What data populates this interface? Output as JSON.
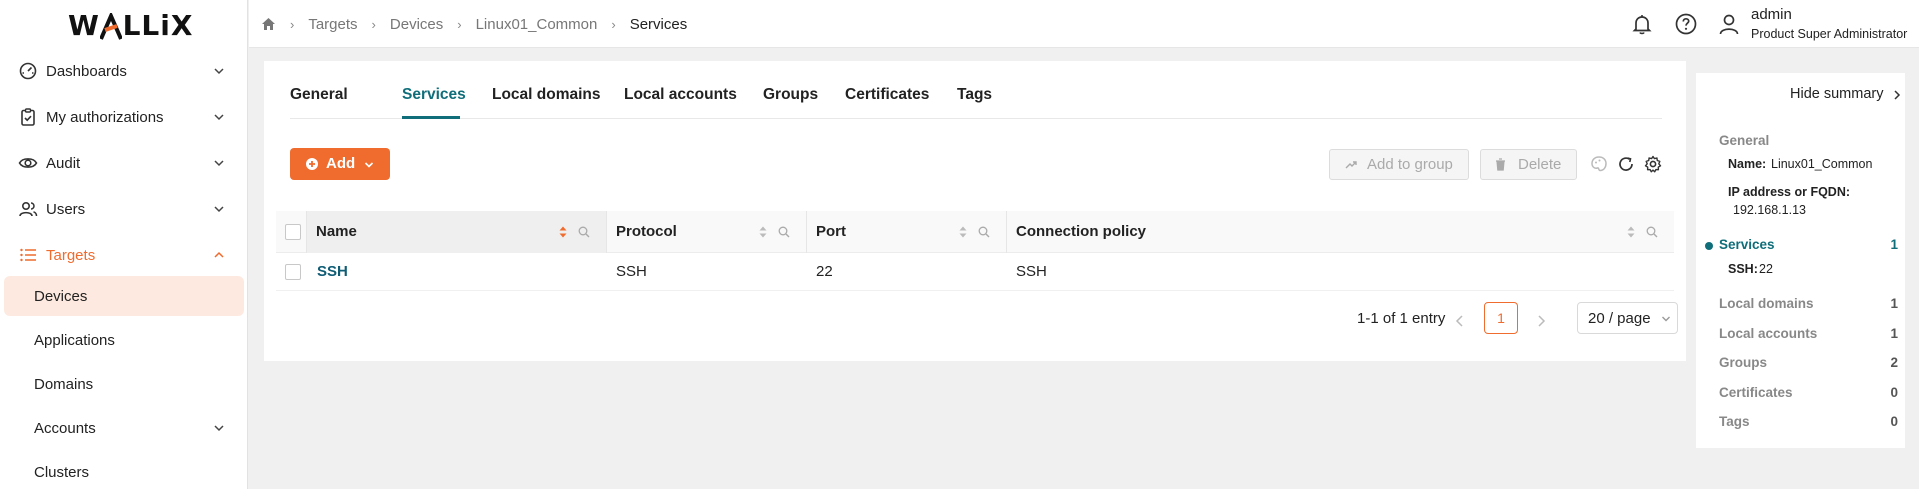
{
  "logo": {
    "text_left": "W",
    "text_mid": "A",
    "text_right": "LLiX"
  },
  "sidebar": {
    "items": [
      {
        "label": "Dashboards",
        "icon": "dashboard-icon"
      },
      {
        "label": "My authorizations",
        "icon": "clipboard-check-icon"
      },
      {
        "label": "Audit",
        "icon": "eye-icon"
      },
      {
        "label": "Users",
        "icon": "users-icon"
      },
      {
        "label": "Targets",
        "icon": "list-icon"
      }
    ],
    "sub_items": [
      {
        "label": "Devices"
      },
      {
        "label": "Applications"
      },
      {
        "label": "Domains"
      },
      {
        "label": "Accounts"
      },
      {
        "label": "Clusters"
      }
    ]
  },
  "breadcrumb": [
    "Targets",
    "Devices",
    "Linux01_Common",
    "Services"
  ],
  "user": {
    "name": "admin",
    "role": "Product Super Administrator"
  },
  "tabs": [
    "General",
    "Services",
    "Local domains",
    "Local accounts",
    "Groups",
    "Certificates",
    "Tags"
  ],
  "toolbar": {
    "add_label": "Add",
    "add_to_group_label": "Add to group",
    "delete_label": "Delete"
  },
  "table": {
    "columns": [
      "Name",
      "Protocol",
      "Port",
      "Connection policy"
    ],
    "rows": [
      {
        "name": "SSH",
        "protocol": "SSH",
        "port": "22",
        "policy": "SSH"
      }
    ]
  },
  "pagination": {
    "summary": "1-1 of 1 entry",
    "current_page": "1",
    "page_size": "20 / page"
  },
  "summary": {
    "hide_label": "Hide summary",
    "general_title": "General",
    "name_label": "Name:",
    "name_value": "Linux01_Common",
    "ip_label": "IP address or FQDN:",
    "ip_value": "192.168.1.13",
    "services_title": "Services",
    "services_count": "1",
    "ssh_label": "SSH:",
    "ssh_value": "22",
    "sections": [
      {
        "title": "Local domains",
        "count": "1"
      },
      {
        "title": "Local accounts",
        "count": "1"
      },
      {
        "title": "Groups",
        "count": "2"
      },
      {
        "title": "Certificates",
        "count": "0"
      },
      {
        "title": "Tags",
        "count": "0"
      }
    ]
  },
  "colors": {
    "accent": "#ef6c2e",
    "teal": "#0f6e7a",
    "selected_bg": "#fde9df"
  }
}
